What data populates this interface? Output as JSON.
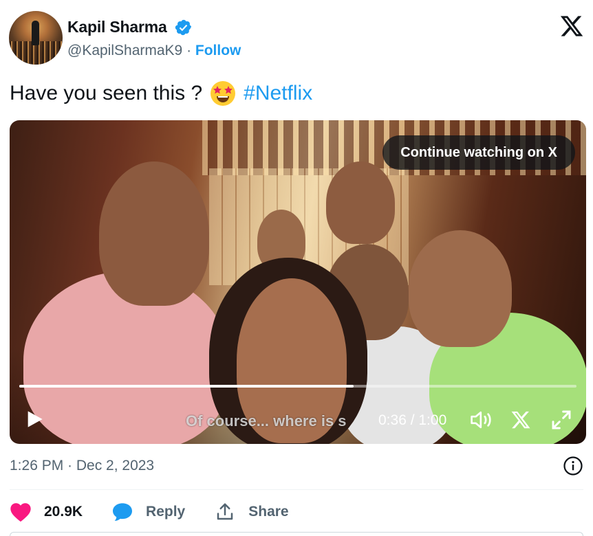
{
  "author": {
    "name": "Kapil Sharma",
    "handle": "@KapilSharmaK9",
    "separator": " · ",
    "follow_label": "Follow"
  },
  "tweet": {
    "text": "Have you seen this ?",
    "emoji": "star-struck-emoji",
    "hashtag": "#Netflix"
  },
  "video": {
    "continue_label": "Continue watching on X",
    "subtitle": "Of course... where is s",
    "time": "0:36 / 1:00",
    "progress": 0.6
  },
  "meta": {
    "timestamp": "1:26 PM · Dec 2, 2023"
  },
  "actions": {
    "likes": "20.9K",
    "reply_label": "Reply",
    "share_label": "Share"
  },
  "colors": {
    "accent": "#1d9bf0",
    "like": "#f91880",
    "text": "#0f1419",
    "muted": "#536471"
  }
}
